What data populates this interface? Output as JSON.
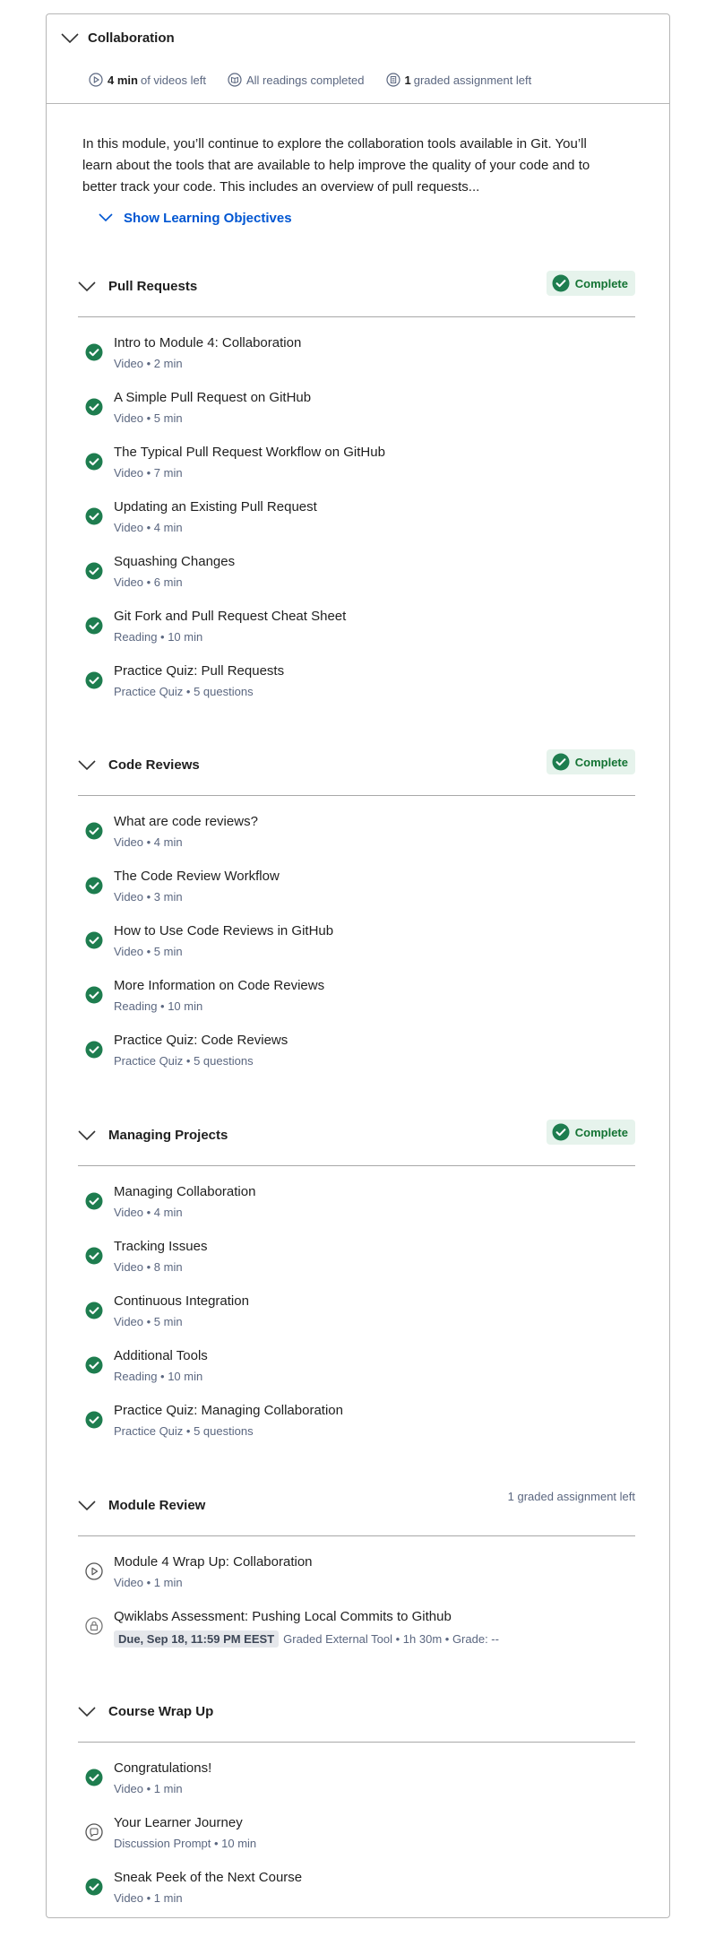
{
  "module": {
    "title": "Collaboration",
    "meta": {
      "videos_strong": "4 min",
      "videos_text": "of videos left",
      "readings_text": "All readings completed",
      "graded_strong": "1",
      "graded_text": "graded assignment left"
    },
    "description": "In this module, you’ll continue to explore the collaboration tools available in Git. You’ll learn about the tools that are available to help improve the quality of your code and to better track your code. This includes an overview of pull requests...",
    "show_objectives": "Show Learning Objectives"
  },
  "colors": {
    "accent": "#0056d2",
    "complete": "#137333",
    "complete_bg": "#e6f3ec",
    "check": "#1e7d4f"
  },
  "lessons": [
    {
      "title": "Pull Requests",
      "status": "Complete",
      "items": [
        {
          "title": "Intro to Module 4: Collaboration",
          "sub": "Video • 2 min",
          "icon": "check-circle-icon"
        },
        {
          "title": "A Simple Pull Request on GitHub",
          "sub": "Video • 5 min",
          "icon": "check-circle-icon"
        },
        {
          "title": "The Typical Pull Request Workflow on GitHub",
          "sub": "Video • 7 min",
          "icon": "check-circle-icon"
        },
        {
          "title": "Updating an Existing Pull Request",
          "sub": "Video • 4 min",
          "icon": "check-circle-icon"
        },
        {
          "title": "Squashing Changes",
          "sub": "Video • 6 min",
          "icon": "check-circle-icon"
        },
        {
          "title": "Git Fork and Pull Request Cheat Sheet",
          "sub": "Reading • 10 min",
          "icon": "check-circle-icon"
        },
        {
          "title": "Practice Quiz: Pull Requests",
          "sub": "Practice Quiz • 5 questions",
          "icon": "check-circle-icon"
        }
      ]
    },
    {
      "title": "Code Reviews",
      "status": "Complete",
      "items": [
        {
          "title": "What are code reviews?",
          "sub": "Video • 4 min",
          "icon": "check-circle-icon"
        },
        {
          "title": "The Code Review Workflow",
          "sub": "Video • 3 min",
          "icon": "check-circle-icon"
        },
        {
          "title": "How to Use Code Reviews in GitHub",
          "sub": "Video • 5 min",
          "icon": "check-circle-icon"
        },
        {
          "title": "More Information on Code Reviews",
          "sub": "Reading • 10 min",
          "icon": "check-circle-icon"
        },
        {
          "title": "Practice Quiz: Code Reviews",
          "sub": "Practice Quiz • 5 questions",
          "icon": "check-circle-icon"
        }
      ]
    },
    {
      "title": "Managing Projects",
      "status": "Complete",
      "items": [
        {
          "title": "Managing Collaboration",
          "sub": "Video • 4 min",
          "icon": "check-circle-icon"
        },
        {
          "title": "Tracking Issues",
          "sub": "Video • 8 min",
          "icon": "check-circle-icon"
        },
        {
          "title": "Continuous Integration",
          "sub": "Video • 5 min",
          "icon": "check-circle-icon"
        },
        {
          "title": "Additional Tools",
          "sub": "Reading • 10 min",
          "icon": "check-circle-icon"
        },
        {
          "title": "Practice Quiz: Managing Collaboration",
          "sub": "Practice Quiz • 5 questions",
          "icon": "check-circle-icon"
        }
      ]
    },
    {
      "title": "Module Review",
      "note": "1 graded assignment left",
      "items": [
        {
          "title": "Module 4 Wrap Up: Collaboration",
          "sub": "Video • 1 min",
          "icon": "play-circle-icon"
        },
        {
          "title": "Qwiklabs Assessment: Pushing Local Commits to Github",
          "due": "Due, Sep 18, 11:59 PM EEST",
          "sub": "Graded External Tool • 1h 30m • Grade: --",
          "icon": "lock-circle-icon"
        }
      ]
    },
    {
      "title": "Course Wrap Up",
      "items": [
        {
          "title": "Congratulations!",
          "sub": "Video • 1 min",
          "icon": "check-circle-icon"
        },
        {
          "title": "Your Learner Journey",
          "sub": "Discussion Prompt • 10 min",
          "icon": "chat-circle-icon"
        },
        {
          "title": "Sneak Peek of the Next Course",
          "sub": "Video • 1 min",
          "icon": "check-circle-icon"
        }
      ]
    }
  ]
}
